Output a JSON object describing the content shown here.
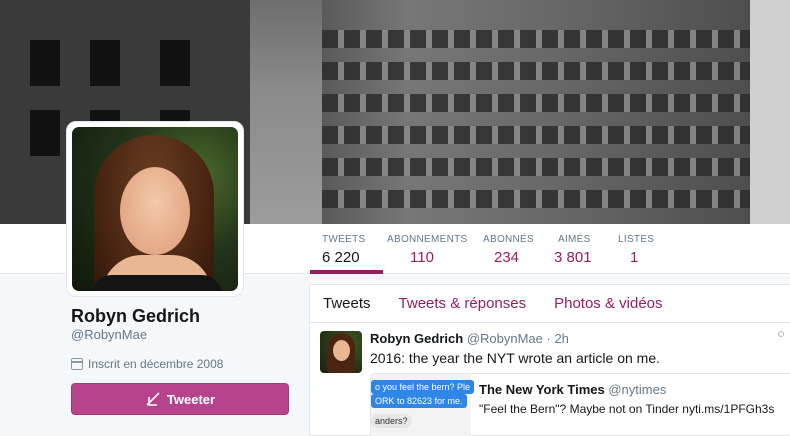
{
  "profile": {
    "name": "Robyn Gedrich",
    "handle": "@RobynMae",
    "joined": "Inscrit en décembre 2008",
    "tweet_button": "Tweeter"
  },
  "stats": [
    {
      "label": "TWEETS",
      "value": "6 220"
    },
    {
      "label": "ABONNEMENTS",
      "value": "110"
    },
    {
      "label": "ABONNÉS",
      "value": "234"
    },
    {
      "label": "AIMÉS",
      "value": "3 801"
    },
    {
      "label": "LISTES",
      "value": "1"
    }
  ],
  "tabs": [
    {
      "label": "Tweets"
    },
    {
      "label": "Tweets & réponses"
    },
    {
      "label": "Photos & vidéos"
    }
  ],
  "tweet": {
    "author": "Robyn Gedrich",
    "handle": "@RobynMae",
    "time": "· 2h",
    "text": "2016: the year the NYT wrote an article on me.",
    "quote": {
      "author": "The New York Times",
      "handle": "@nytimes",
      "text": "\"Feel the Bern\"? Maybe not on Tinder nyti.ms/1PFGh3s",
      "bubble1": "o you feel the bern? Ple",
      "bubble2": "ORK to 82623 for me.",
      "bubble3": "anders?"
    }
  },
  "colors": {
    "accent": "#9b1c5c",
    "button": "#b8438d"
  }
}
